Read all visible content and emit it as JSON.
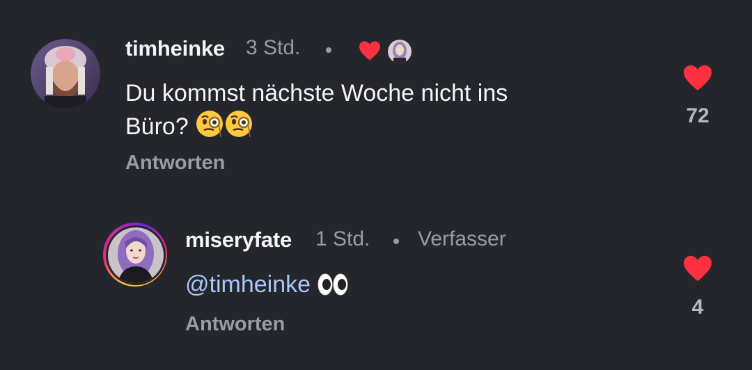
{
  "comments": [
    {
      "username": "timheinke",
      "time": "3 Std.",
      "text": "Du kommst nächste Woche nicht ins",
      "text_line2": "Büro?",
      "emojis": [
        "monocle-face",
        "monocle-face"
      ],
      "reply_label": "Antworten",
      "like_count": "72",
      "liked_by_author": true
    },
    {
      "username": "miseryfate",
      "time": "1 Std.",
      "badge": "Verfasser",
      "mention": "@timheinke",
      "emojis": [
        "eyes"
      ],
      "reply_label": "Antworten",
      "like_count": "4"
    }
  ],
  "colors": {
    "background": "#25262b",
    "like_red": "#ff3040",
    "mention_blue": "#a8c7fa",
    "muted": "#9a9ca3"
  }
}
